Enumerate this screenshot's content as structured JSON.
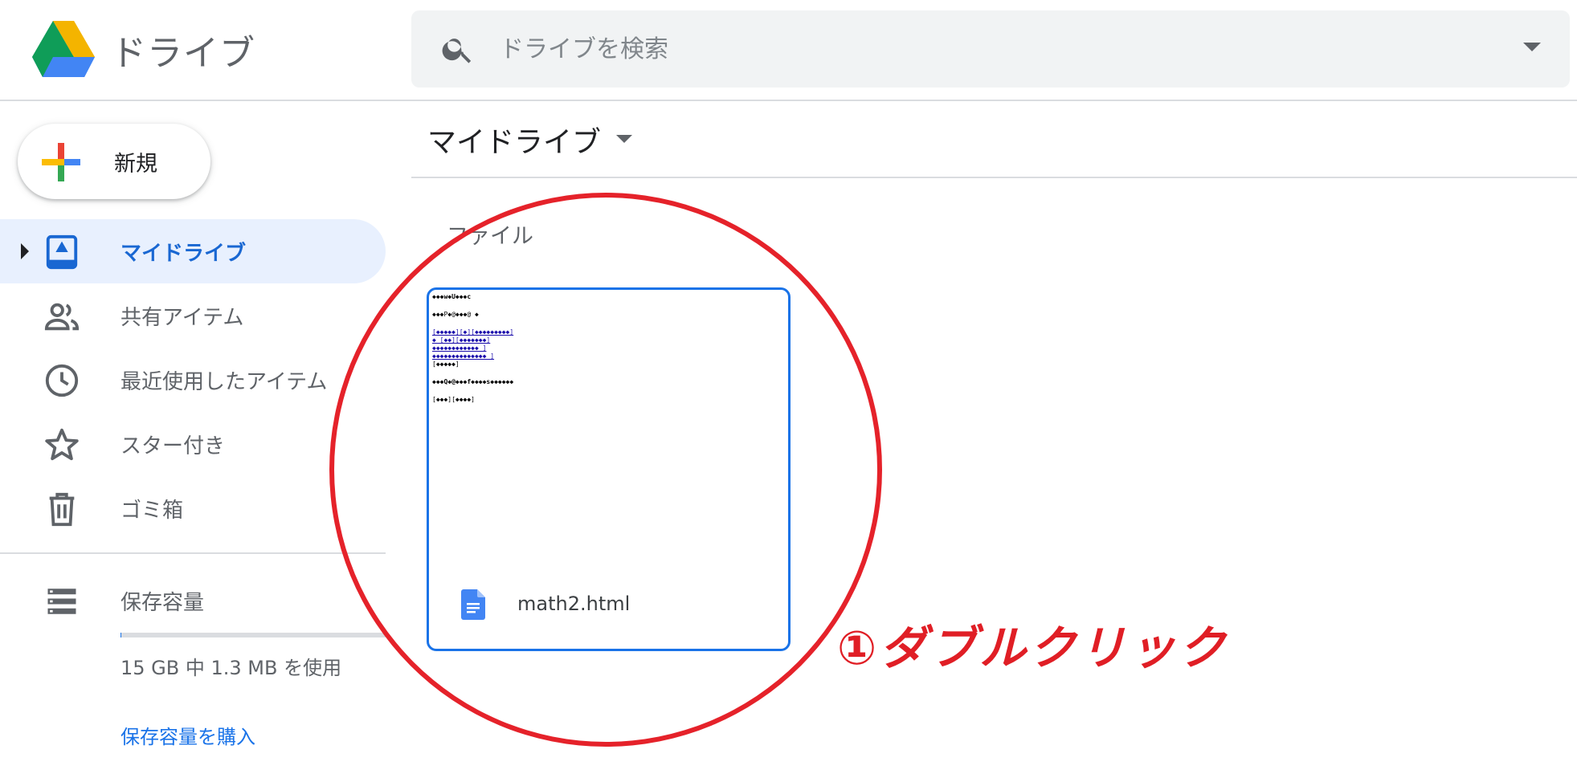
{
  "header": {
    "app_title": "ドライブ",
    "search_placeholder": "ドライブを検索",
    "logo_icon": "google-drive-logo",
    "brand_colors": [
      "#0f9d58",
      "#f4b400",
      "#4285f4"
    ]
  },
  "sidebar": {
    "new_label": "新規",
    "items": [
      {
        "label": "マイドライブ",
        "icon": "my-drive-icon",
        "active": true
      },
      {
        "label": "共有アイテム",
        "icon": "people-icon"
      },
      {
        "label": "最近使用したアイテム",
        "icon": "clock-icon"
      },
      {
        "label": "スター付き",
        "icon": "star-icon"
      },
      {
        "label": "ゴミ箱",
        "icon": "trash-icon"
      }
    ],
    "storage": {
      "label": "保存容量",
      "usage": "15 GB 中 1.3 MB を使用",
      "buy": "保存容量を購入",
      "used_fraction": 0.0001
    }
  },
  "main": {
    "title": "マイドライブ",
    "section": "ファイル",
    "file": {
      "name": "math2.html",
      "icon": "docs-icon",
      "preview_lines": [
        {
          "text": "◆◆◆w◆U◆◆◆c",
          "blue": false,
          "bold": true
        },
        {
          "text": "",
          "gap": true
        },
        {
          "text": "◆◆◆P◆@◆◆◆@ ◆",
          "blue": false
        },
        {
          "text": "",
          "gap": true
        },
        {
          "text": "[◆◆◆◆◆][◆][◆◆◆◆◆◆◆◆◆]",
          "blue": true
        },
        {
          "text": "◆_[◆◆][◆◆◆◆◆◆◆]",
          "blue": true
        },
        {
          "text": "◆◆◆◆◆◆◆◆◆◆◆◆_]",
          "blue": true
        },
        {
          "text": "◆◆◆◆◆◆◆◆◆◆◆◆◆◆_]",
          "blue": true
        },
        {
          "text": "[◆◆◆◆◆]",
          "blue": false
        },
        {
          "text": "",
          "gap": true
        },
        {
          "text": "◆◆◆Q◆@◆◆◆f◆◆◆◆s◆◆◆◆◆◆",
          "blue": false,
          "bold": true
        },
        {
          "text": "",
          "gap": true
        },
        {
          "text": "[◆◆◆][◆◆◆◆]",
          "blue": false
        }
      ]
    }
  },
  "annotation": {
    "text": "①ダブルクリック",
    "color": "#e01e25"
  }
}
